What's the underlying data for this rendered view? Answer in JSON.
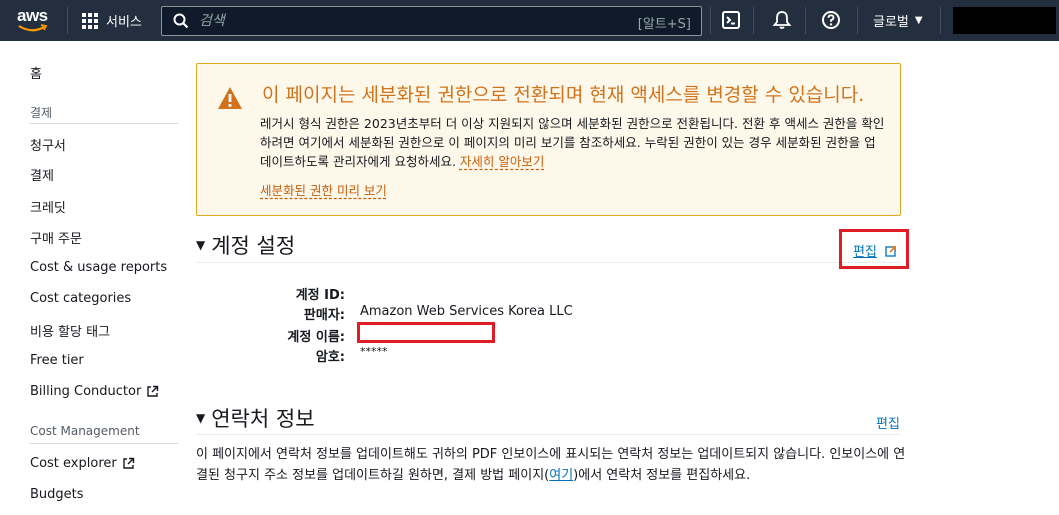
{
  "nav": {
    "logo": "aws",
    "services_label": "서비스",
    "search_placeholder": "검색",
    "search_shortcut": "[알트+S]",
    "region_label": "글로벌",
    "icons": [
      "grid-icon",
      "search-icon",
      "cloudshell-icon",
      "bell-icon",
      "help-icon",
      "caret-down-icon"
    ]
  },
  "sidebar": {
    "home": "홈",
    "section_billing": "결제",
    "items_billing": [
      "청구서",
      "결제",
      "크레딧",
      "구매 주문",
      "Cost & usage reports",
      "Cost categories",
      "비용 할당 태그",
      "Free tier",
      "Billing Conductor"
    ],
    "section_cost": "Cost Management",
    "items_cost": [
      "Cost explorer",
      "Budgets"
    ]
  },
  "alert": {
    "title": "이 페이지는 세분화된 권한으로 전환되며 현재 액세스를 변경할 수 있습니다.",
    "body": "레거시 형식 권한은 2023년초부터 더 이상 지원되지 않으며 세분화된 권한으로 전환됩니다. 전환 후 액세스 권한을 확인하려면 여기에서 세분화된 권한으로 이 페이지의 미리 보기를 참조하세요. 누락된 권한이 있는 경우 세분화된 권한을 업데이트하도록 관리자에게 요청하세요.",
    "learn_more": "자세히 알아보기",
    "preview_link": "세분화된 권한 미리 보기"
  },
  "account_settings": {
    "title": "계정 설정",
    "edit": "편집",
    "fields": [
      {
        "label": "계정 ID:",
        "value": ""
      },
      {
        "label": "판매자:",
        "value": "Amazon Web Services Korea LLC"
      },
      {
        "label": "계정 이름:",
        "value": ""
      },
      {
        "label": "암호:",
        "value": "*****"
      }
    ]
  },
  "contact_info": {
    "title": "연락처 정보",
    "edit": "편집",
    "body_before": "이 페이지에서 연락처 정보를 업데이트해도 귀하의 PDF 인보이스에 표시되는 연락처 정보는 업데이트되지 않습니다. 인보이스에 연결된 청구지 주소 정보를 업데이트하길 원하면, 결제 방법 페이지(",
    "body_link": "여기",
    "body_after": ")에서 연락처 정보를 편집하세요."
  },
  "colors": {
    "nav_bg": "#232f3e",
    "alert_bg": "#fef8ea",
    "alert_border": "#e0a91b",
    "warning_orange": "#d0731c",
    "link_blue": "#0073bb",
    "highlight_red": "#e01c24"
  }
}
